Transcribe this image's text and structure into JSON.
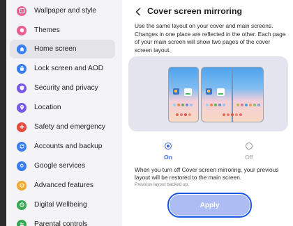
{
  "sidebar": {
    "items": [
      {
        "label": "Wallpaper and style",
        "icon": "wallpaper-icon",
        "color": "#e85d8f"
      },
      {
        "label": "Themes",
        "icon": "themes-icon",
        "color": "#e85d8f"
      },
      {
        "label": "Home screen",
        "icon": "home-icon",
        "color": "#3a7ef5",
        "selected": true
      },
      {
        "label": "Lock screen and AOD",
        "icon": "lock-icon",
        "color": "#3a7ef5"
      },
      {
        "label": "Security and privacy",
        "icon": "shield-icon",
        "color": "#7858e6"
      },
      {
        "label": "Location",
        "icon": "location-pin-icon",
        "color": "#7858e6"
      },
      {
        "label": "Safety and emergency",
        "icon": "emergency-icon",
        "color": "#e3493b"
      },
      {
        "label": "Accounts and backup",
        "icon": "sync-icon",
        "color": "#3a7ef5"
      },
      {
        "label": "Google services",
        "icon": "google-icon",
        "color": "#3a7ef5"
      },
      {
        "label": "Advanced features",
        "icon": "star-gear-icon",
        "color": "#f0a82e"
      },
      {
        "label": "Digital Wellbeing",
        "icon": "wellbeing-icon",
        "color": "#34a853"
      },
      {
        "label": "Parental controls",
        "icon": "parental-icon",
        "color": "#34a853"
      }
    ]
  },
  "main": {
    "title": "Cover screen mirroring",
    "description": "Use the same layout on your cover and main screens. Changes in one place are reflected in the other. Each page of your main screen will show two pages of the cover screen layout.",
    "options": {
      "on_label": "On",
      "off_label": "Off",
      "selected": "On"
    },
    "note": "When you turn off Cover screen mirroring, your previous layout will be restored to the main screen.",
    "backup_status": "Previous layout backed up.",
    "apply_label": "Apply"
  },
  "colors": {
    "accent": "#3e66d9",
    "apply_button_fill": "#aebcf4",
    "apply_button_border": "#1b56e6",
    "preview_background": "#e3e4ed"
  }
}
